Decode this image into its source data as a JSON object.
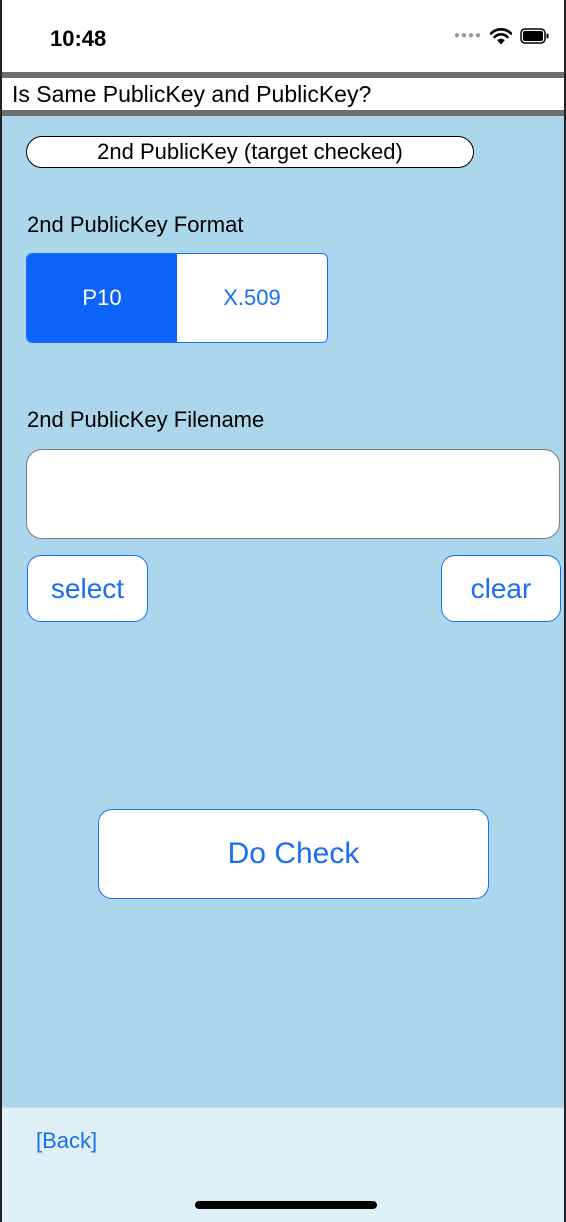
{
  "status_bar": {
    "time": "10:48",
    "icons": [
      "cellular-dots-icon",
      "wifi-icon",
      "battery-icon"
    ]
  },
  "title_bar": {
    "title": "Is Same PublicKey and PublicKey?"
  },
  "main": {
    "target_label": "2nd PublicKey (target checked)",
    "format_label": "2nd PublicKey Format",
    "format_segments": [
      {
        "label": "P10",
        "selected": true
      },
      {
        "label": "X.509",
        "selected": false
      }
    ],
    "filename_label": "2nd PublicKey Filename",
    "filename_value": "",
    "select_button": "select",
    "clear_button": "clear",
    "do_check_button": "Do Check"
  },
  "bottom_bar": {
    "back_link": "[Back]"
  },
  "colors": {
    "background": "#acd6eb",
    "accent": "#1a6ef5",
    "selected_segment": "#0b63fa",
    "bottom_bar": "#dfeff6",
    "title_border": "#6e6e6e"
  }
}
